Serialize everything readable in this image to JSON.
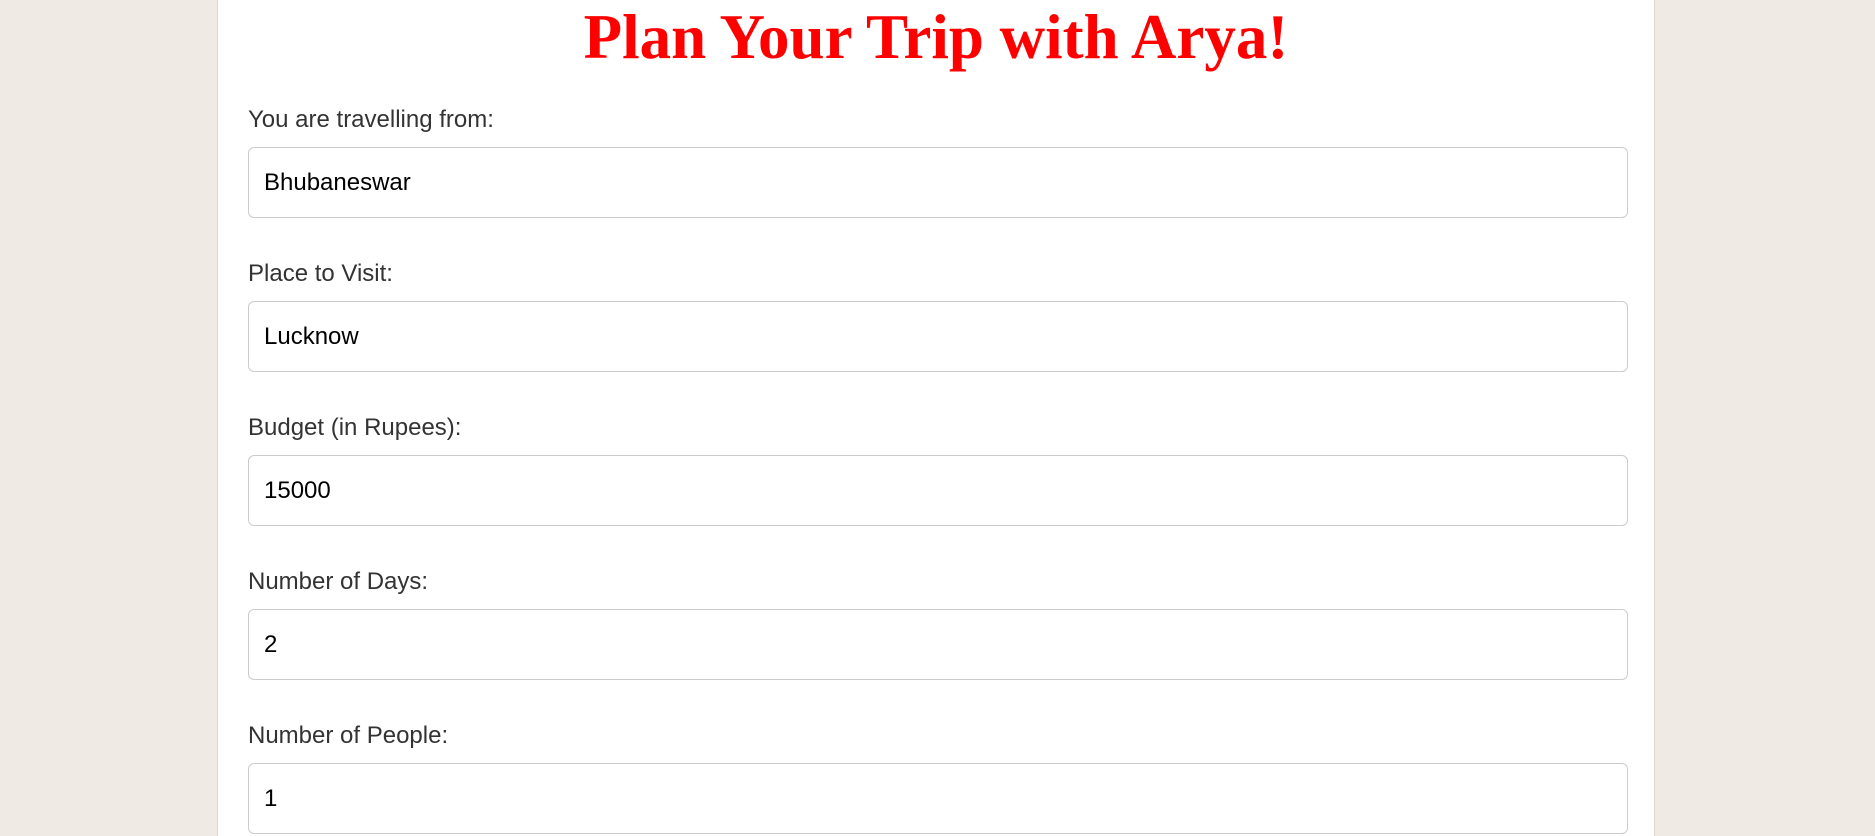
{
  "page": {
    "title": "Plan Your Trip with Arya!"
  },
  "form": {
    "fields": [
      {
        "label": "You are travelling from:",
        "value": "Bhubaneswar"
      },
      {
        "label": "Place to Visit:",
        "value": "Lucknow"
      },
      {
        "label": "Budget (in Rupees):",
        "value": "15000"
      },
      {
        "label": "Number of Days:",
        "value": "2"
      },
      {
        "label": "Number of People:",
        "value": "1"
      }
    ]
  },
  "colors": {
    "title": "#ff0000",
    "background": "#efebe4",
    "panel": "#ffffff",
    "label": "#333333",
    "input_border": "#cccccc"
  }
}
